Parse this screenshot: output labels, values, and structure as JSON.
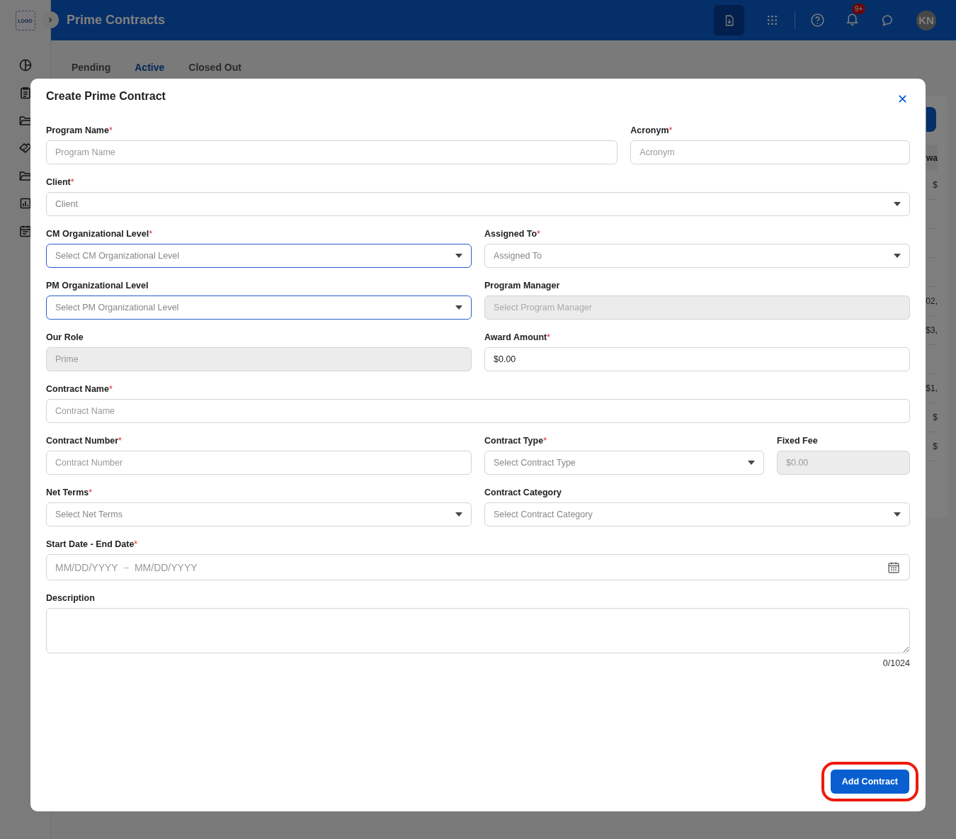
{
  "app": {
    "logo": "LOGO",
    "title": "Prime Contracts",
    "notification_count": "9+",
    "avatar_initials": "KN"
  },
  "sidebar": {
    "items": [
      {
        "kind": "chart"
      },
      {
        "kind": "clipboard"
      },
      {
        "kind": "folder"
      },
      {
        "kind": "handshake"
      },
      {
        "kind": "folder"
      },
      {
        "kind": "report"
      },
      {
        "kind": "calendar"
      }
    ]
  },
  "tabs": [
    {
      "label": "Pending",
      "selected": false
    },
    {
      "label": "Active",
      "selected": true
    },
    {
      "label": "Closed Out",
      "selected": false
    }
  ],
  "background_table": {
    "header": "wa",
    "rows": [
      {
        "cell": "$"
      },
      {},
      {},
      {},
      {
        "cell": "02,"
      },
      {
        "cell": "$3,"
      },
      {},
      {
        "cell": "$1,"
      },
      {
        "cell": "$"
      },
      {
        "cell": "$"
      }
    ]
  },
  "modal": {
    "title": "Create Prime Contract",
    "rows": [
      [
        {
          "label": "Program Name",
          "required_mark": "*",
          "kind": "text",
          "placeholder": "Program Name",
          "disabled": false,
          "active": false
        },
        {
          "label": "Acronym",
          "required_mark": "*",
          "kind": "text",
          "placeholder": "Acronym",
          "disabled": false,
          "active": false
        }
      ],
      [
        {
          "label": "Client",
          "required_mark": "*",
          "kind": "select",
          "placeholder": "Client",
          "disabled": false,
          "active": false
        }
      ],
      [
        {
          "label": "CM Organizational Level",
          "required_mark": "*",
          "kind": "select",
          "placeholder": "Select CM Organizational Level",
          "disabled": false,
          "active": true
        },
        {
          "label": "Assigned To",
          "required_mark": "*",
          "kind": "select",
          "placeholder": "Assigned To",
          "disabled": false,
          "active": false
        }
      ],
      [
        {
          "label": "PM Organizational Level",
          "kind": "select",
          "placeholder": "Select PM Organizational Level",
          "disabled": false,
          "active": true
        },
        {
          "label": "Program Manager",
          "kind": "select",
          "placeholder": "Select Program Manager",
          "disabled": true,
          "active": false
        }
      ],
      [
        {
          "label": "Our Role",
          "kind": "text",
          "placeholder": "Prime",
          "disabled": true,
          "active": false
        },
        {
          "label": "Award Amount",
          "required_mark": "*",
          "kind": "text",
          "value": "$0.00",
          "disabled": false,
          "active": false
        }
      ],
      [
        {
          "label": "Contract Name",
          "required_mark": "*",
          "kind": "text",
          "placeholder": "Contract Name",
          "disabled": false,
          "active": false
        }
      ],
      [
        {
          "label": "Contract Number",
          "required_mark": "*",
          "kind": "text",
          "placeholder": "Contract Number",
          "disabled": false,
          "active": false
        },
        {
          "label": "Contract Type",
          "required_mark": "*",
          "kind": "select",
          "placeholder": "Select Contract Type",
          "disabled": false,
          "active": false
        },
        {
          "label": "Fixed Fee",
          "kind": "text",
          "placeholder": "$0.00",
          "disabled": true,
          "active": false
        }
      ],
      [
        {
          "label": "Net Terms",
          "required_mark": "*",
          "kind": "select",
          "placeholder": "Select Net Terms",
          "disabled": false,
          "active": false
        },
        {
          "label": "Contract Category",
          "kind": "select",
          "placeholder": "Select Contract Category",
          "disabled": false,
          "active": false
        }
      ],
      [
        {
          "label": "Start Date - End Date",
          "required_mark": "*",
          "kind": "daterange",
          "start_placeholder": "MM/DD/YYYY",
          "separator": "–",
          "end_placeholder": "MM/DD/YYYY",
          "disabled": false,
          "active": false
        }
      ],
      [
        {
          "label": "Description",
          "kind": "textarea",
          "counter": "0/1024",
          "disabled": false,
          "active": false
        }
      ]
    ],
    "submit": {
      "label": "Add Contract",
      "highlighted": true
    }
  }
}
